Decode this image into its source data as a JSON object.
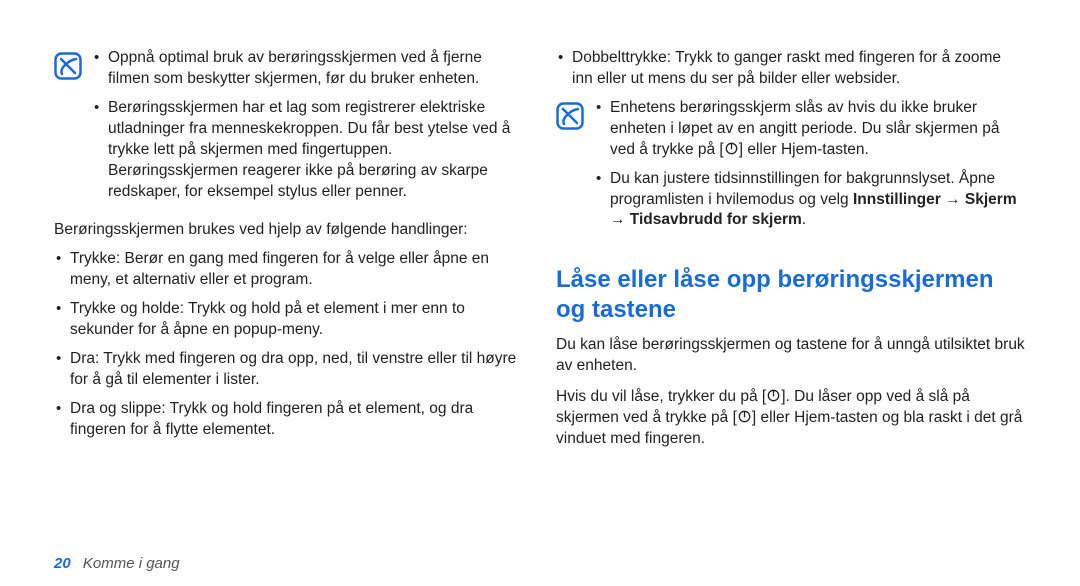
{
  "left": {
    "note_bullets": [
      "Oppnå optimal bruk av berøringsskjermen ved å fjerne filmen som beskytter skjermen, før du bruker enheten.",
      "Berøringsskjermen har et lag som registrerer elektriske utladninger fra menneskekroppen. Du får best ytelse ved å trykke lett på skjermen med fingertuppen. Berøringsskjermen reagerer ikke på berøring av skarpe redskaper, for eksempel stylus eller penner."
    ],
    "intro": "Berøringsskjermen brukes ved hjelp av følgende handlinger:",
    "main_bullets": [
      "Trykke: Berør en gang med fingeren for å velge eller åpne en meny, et alternativ eller et program.",
      "Trykke og holde: Trykk og hold på et element i mer enn to sekunder for å åpne en popup-meny.",
      "Dra: Trykk med fingeren og dra opp, ned, til venstre eller til høyre for å gå til elementer i lister.",
      "Dra og slippe: Trykk og hold fingeren på et element, og dra fingeren for å flytte elementet."
    ]
  },
  "right": {
    "top_bullet": "Dobbelttrykke: Trykk to ganger raskt med fingeren for å zoome inn eller ut mens du ser på bilder eller websider.",
    "note_b1_pre": "Enhetens berøringsskjerm slås av hvis du ikke bruker enheten i løpet av en angitt periode. Du slår skjermen på ved å trykke på [",
    "note_b1_post": "] eller Hjem-tasten.",
    "note_b2_pre": "Du kan justere tidsinnstillingen for bakgrunnslyset. Åpne programlisten i hvilemodus og velg ",
    "note_b2_bold": "Innstillinger → Skjerm → Tidsavbrudd for skjerm",
    "note_b2_post": ".",
    "heading": "Låse eller låse opp berøringsskjermen og tastene",
    "para1": "Du kan låse berøringsskjermen og tastene for å unngå utilsiktet bruk av enheten.",
    "para2_pre": "Hvis du vil låse, trykker du på [",
    "para2_mid": "]. Du låser opp ved å slå på skjermen ved å trykke på [",
    "para2_post": "] eller Hjem-tasten og bla raskt i det grå vinduet med fingeren."
  },
  "footer": {
    "page": "20",
    "section": "Komme i gang"
  },
  "icon_names": {
    "note": "note-icon",
    "power": "power-icon"
  }
}
